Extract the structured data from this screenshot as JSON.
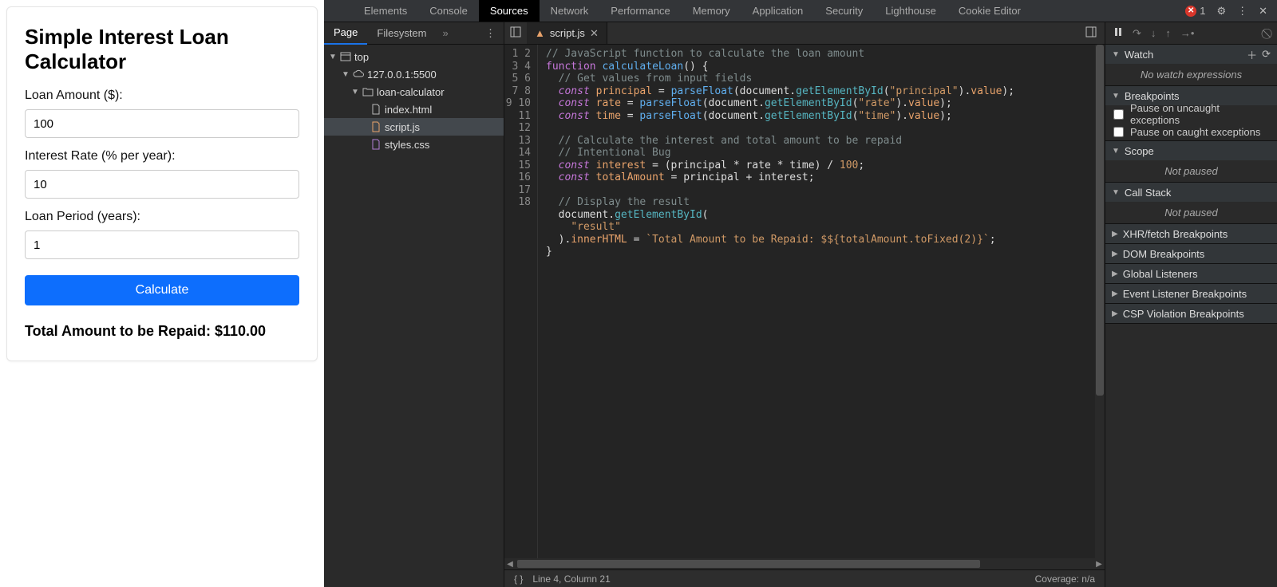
{
  "app": {
    "title": "Simple Interest Loan Calculator",
    "labels": {
      "amount": "Loan Amount ($):",
      "rate": "Interest Rate (% per year):",
      "period": "Loan Period (years):"
    },
    "values": {
      "amount": "100",
      "rate": "10",
      "period": "1"
    },
    "button": "Calculate",
    "result": "Total Amount to be Repaid: $110.00"
  },
  "devtools": {
    "error_count": "1",
    "tabs": [
      "Elements",
      "Console",
      "Sources",
      "Network",
      "Performance",
      "Memory",
      "Application",
      "Security",
      "Lighthouse",
      "Cookie Editor"
    ],
    "active_tab": "Sources",
    "nav": {
      "tabs": {
        "page": "Page",
        "filesystem": "Filesystem"
      },
      "tree": {
        "top": "top",
        "host": "127.0.0.1:5500",
        "folder": "loan-calculator",
        "files": {
          "index": "index.html",
          "script": "script.js",
          "styles": "styles.css"
        }
      }
    },
    "editor": {
      "tab_label": "script.js",
      "line_count": 18,
      "status_pos": "Line 4, Column 21",
      "coverage": "Coverage: n/a",
      "code_lines": [
        [
          [
            "c",
            "// JavaScript function to calculate the loan amount"
          ]
        ],
        [
          [
            "k",
            "function "
          ],
          [
            "f",
            "calculateLoan"
          ],
          [
            "p",
            "() {"
          ]
        ],
        [
          [
            "p",
            "  "
          ],
          [
            "c",
            "// Get values from input fields"
          ]
        ],
        [
          [
            "p",
            "  "
          ],
          [
            "d",
            "const "
          ],
          [
            "v",
            "principal"
          ],
          [
            "p",
            " = "
          ],
          [
            "f",
            "parseFloat"
          ],
          [
            "p",
            "(document."
          ],
          [
            "m",
            "getElementById"
          ],
          [
            "p",
            "("
          ],
          [
            "s",
            "\"principal\""
          ],
          [
            "p",
            ")."
          ],
          [
            "v",
            "value"
          ],
          [
            "p",
            ");"
          ]
        ],
        [
          [
            "p",
            "  "
          ],
          [
            "d",
            "const "
          ],
          [
            "v",
            "rate"
          ],
          [
            "p",
            " = "
          ],
          [
            "f",
            "parseFloat"
          ],
          [
            "p",
            "(document."
          ],
          [
            "m",
            "getElementById"
          ],
          [
            "p",
            "("
          ],
          [
            "s",
            "\"rate\""
          ],
          [
            "p",
            ")."
          ],
          [
            "v",
            "value"
          ],
          [
            "p",
            ");"
          ]
        ],
        [
          [
            "p",
            "  "
          ],
          [
            "d",
            "const "
          ],
          [
            "v",
            "time"
          ],
          [
            "p",
            " = "
          ],
          [
            "f",
            "parseFloat"
          ],
          [
            "p",
            "(document."
          ],
          [
            "m",
            "getElementById"
          ],
          [
            "p",
            "("
          ],
          [
            "s",
            "\"time\""
          ],
          [
            "p",
            ")."
          ],
          [
            "v",
            "value"
          ],
          [
            "p",
            ");"
          ]
        ],
        [],
        [
          [
            "p",
            "  "
          ],
          [
            "c",
            "// Calculate the interest and total amount to be repaid"
          ]
        ],
        [
          [
            "p",
            "  "
          ],
          [
            "c",
            "// Intentional Bug"
          ]
        ],
        [
          [
            "p",
            "  "
          ],
          [
            "d",
            "const "
          ],
          [
            "v",
            "interest"
          ],
          [
            "p",
            " = (principal * rate * time) / "
          ],
          [
            "n",
            "100"
          ],
          [
            "p",
            ";"
          ]
        ],
        [
          [
            "p",
            "  "
          ],
          [
            "d",
            "const "
          ],
          [
            "v",
            "totalAmount"
          ],
          [
            "p",
            " = principal + interest;"
          ]
        ],
        [],
        [
          [
            "p",
            "  "
          ],
          [
            "c",
            "// Display the result"
          ]
        ],
        [
          [
            "p",
            "  document."
          ],
          [
            "m",
            "getElementById"
          ],
          [
            "p",
            "("
          ]
        ],
        [
          [
            "p",
            "    "
          ],
          [
            "s",
            "\"result\""
          ]
        ],
        [
          [
            "p",
            "  )."
          ],
          [
            "v",
            "innerHTML"
          ],
          [
            "p",
            " = "
          ],
          [
            "s",
            "`Total Amount to be Repaid: $${totalAmount.toFixed(2)}`"
          ],
          [
            "p",
            ";"
          ]
        ],
        [
          [
            "p",
            "}"
          ]
        ],
        []
      ]
    },
    "right": {
      "watch": {
        "title": "Watch",
        "empty": "No watch expressions"
      },
      "breakpoints": {
        "title": "Breakpoints",
        "uncaught": "Pause on uncaught exceptions",
        "caught": "Pause on caught exceptions"
      },
      "scope": {
        "title": "Scope",
        "msg": "Not paused"
      },
      "callstack": {
        "title": "Call Stack",
        "msg": "Not paused"
      },
      "collapsed": {
        "xhr": "XHR/fetch Breakpoints",
        "dom": "DOM Breakpoints",
        "global": "Global Listeners",
        "event": "Event Listener Breakpoints",
        "csp": "CSP Violation Breakpoints"
      }
    }
  }
}
